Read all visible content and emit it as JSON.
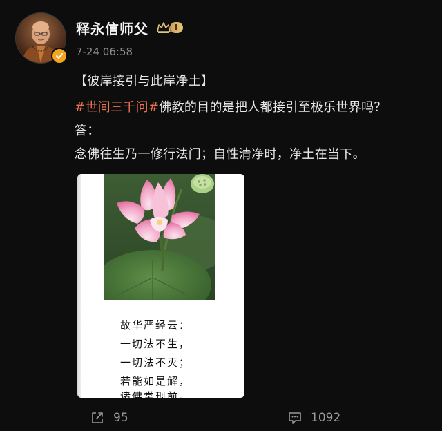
{
  "post": {
    "author": {
      "name": "释永信师父",
      "vip_level": "I",
      "verified": true
    },
    "timestamp": "7-24 06:58",
    "content": {
      "title_line": "【彼岸接引与此岸净土】",
      "hashtag": "#世间三千问#",
      "question": "佛教的目的是把人都接引至极乐世界吗？",
      "answer_label": "答：",
      "answer": "念佛往生乃一修行法门；自性清净时，净土在当下。"
    },
    "image": {
      "subject": "pink lotus flower with lotus seed pod and green leaves",
      "verse_lines": [
        "故华严经云：",
        "一切法不生，",
        "一切法不灭；",
        "若能如是解，",
        "诸佛常现前。"
      ]
    },
    "actions": {
      "share_count": "95",
      "comment_count": "1092"
    },
    "colors": {
      "background": "#0d0d0d",
      "hashtag": "#eb7350",
      "verified_badge": "#f2a422",
      "vip_badge": "#caa256",
      "muted_text": "#8c8c8c"
    },
    "icons": {
      "share": "share-icon",
      "comment": "comment-icon",
      "verified": "verified-icon",
      "vip": "crown-icon"
    }
  }
}
